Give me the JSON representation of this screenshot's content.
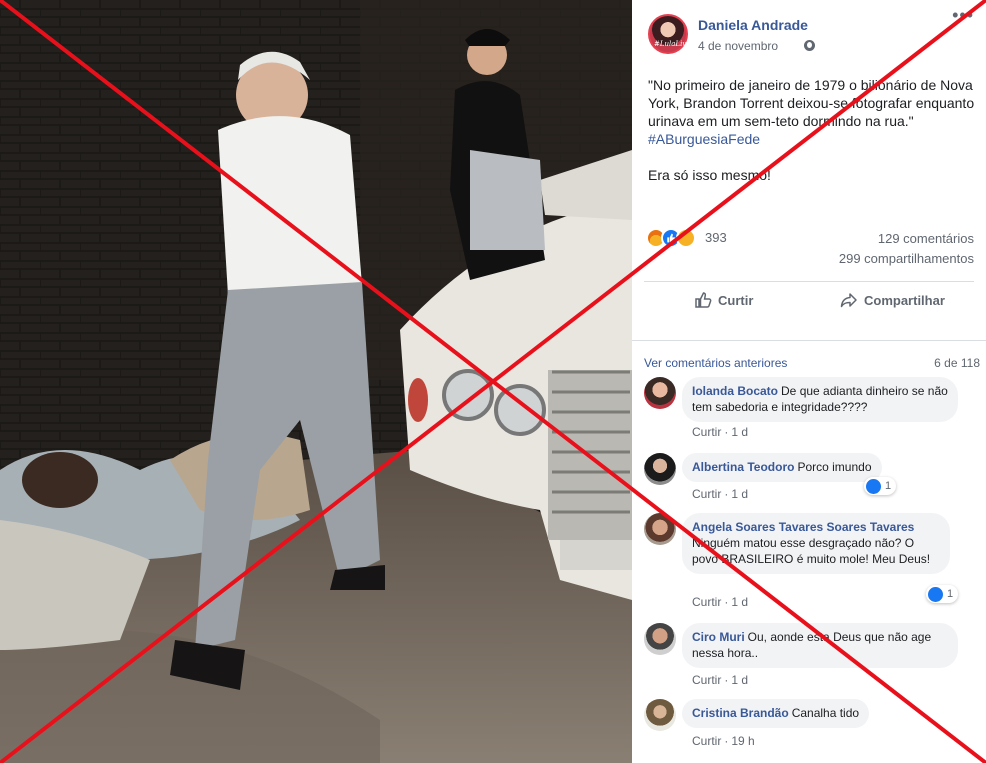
{
  "photo": {
    "description_icon": "photo-image"
  },
  "post": {
    "author": "Daniela Andrade",
    "date": "4 de novembro",
    "avatar_caption": "#LulaLivre",
    "text_main": "\"No primeiro de janeiro de 1979 o bilionário de Nova York, Brandon Torrent deixou-se fotografar enquanto urinava em um sem-teto dormindo na rua.\"",
    "hashtag": "#ABurguesiaFede",
    "text_tail": "Era só isso mesmo!",
    "reaction_count": "393",
    "comments_count": "129 comentários",
    "shares_count": "299 compartilhamentos",
    "like_label": "Curtir",
    "share_label": "Compartilhar"
  },
  "comments_header": {
    "previous_label": "Ver comentários anteriores",
    "pager": "6 de 118"
  },
  "comments": [
    {
      "name": "Iolanda Bocato",
      "text": "De que adianta dinheiro se não tem sabedoria e integridade????",
      "reply": "Curtir",
      "time": "1 d",
      "reactions": ""
    },
    {
      "name": "Albertina Teodoro",
      "text": "Porco imundo",
      "reply": "Curtir",
      "time": "1 d",
      "reactions": "1"
    },
    {
      "name": "Angela Soares Tavares Soares Tavares",
      "text": "Ninguém matou esse desgraçado não? O povo BRASILEIRO é muito mole! Meu Deus!",
      "reply": "Curtir",
      "time": "1 d",
      "reactions": "1"
    },
    {
      "name": "Ciro Muri",
      "text": "Ou, aonde esta Deus que não age nessa hora..",
      "reply": "Curtir",
      "time": "1 d",
      "reactions": ""
    },
    {
      "name": "Cristina Brandão",
      "text": "Canalha tido",
      "reply": "Curtir",
      "time": "19 h",
      "reactions": ""
    }
  ],
  "colors": {
    "link": "#385898",
    "muted": "#606770",
    "bubble": "#f2f3f5",
    "x_overlay": "#e8111b",
    "like_blue": "#1877f2"
  }
}
